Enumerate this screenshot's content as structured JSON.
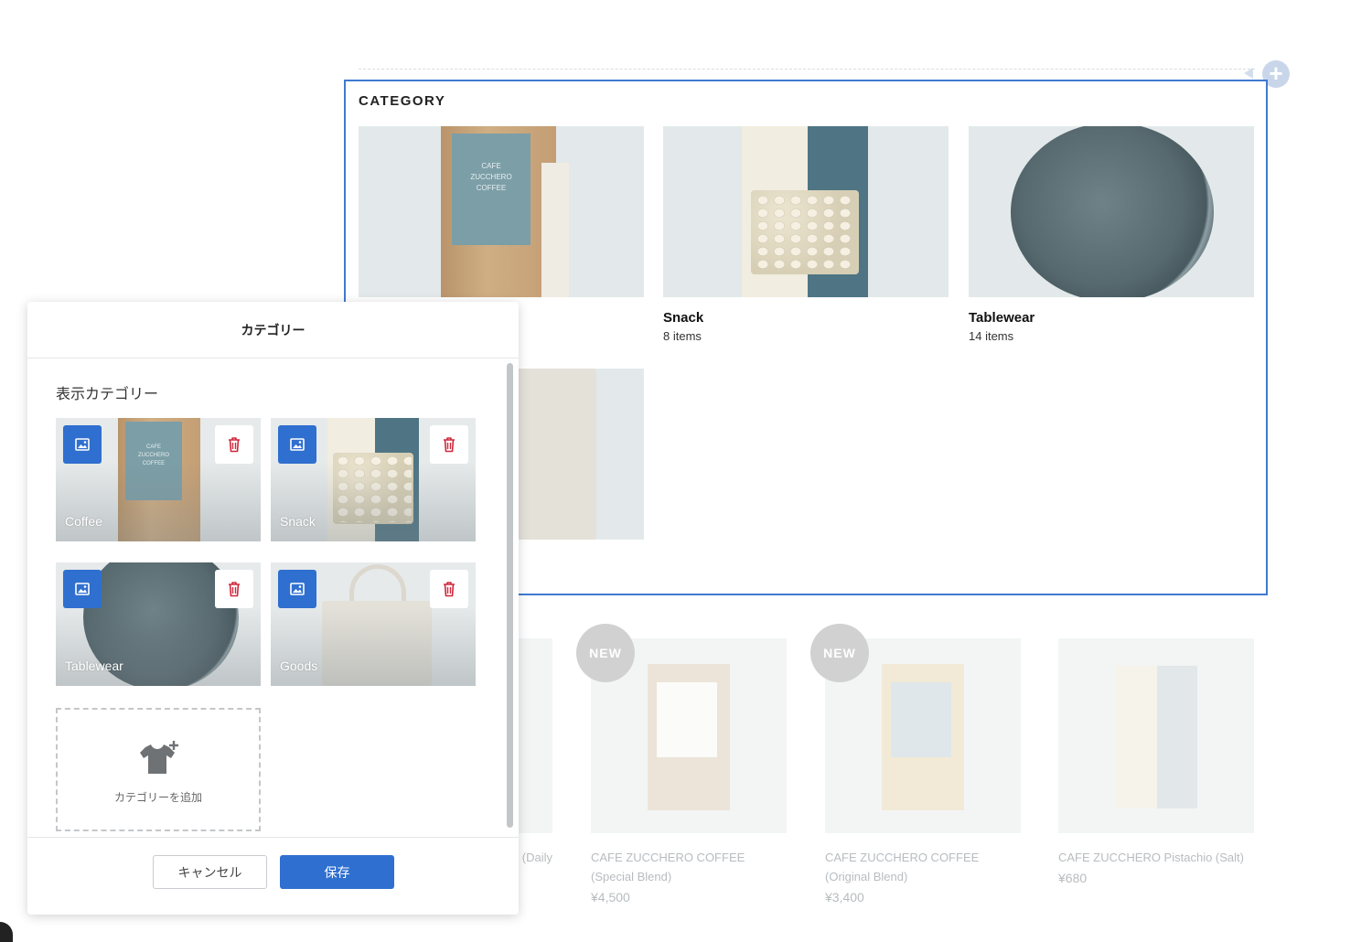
{
  "section": {
    "title": "CATEGORY",
    "add_icon": "plus-icon",
    "categories": [
      {
        "name": "Coffee",
        "count": "",
        "image": "coffee-bag"
      },
      {
        "name": "Snack",
        "count": "8 items",
        "image": "pistachio-pouch"
      },
      {
        "name": "Tablewear",
        "count": "14 items",
        "image": "plate"
      },
      {
        "name": "Goods",
        "count": "",
        "image": "tote-bag"
      }
    ]
  },
  "products": [
    {
      "name": "(Daily",
      "price": "",
      "new": false
    },
    {
      "name": "CAFE ZUCCHERO COFFEE (Special Blend)",
      "price": "¥4,500",
      "new": true
    },
    {
      "name": "CAFE ZUCCHERO COFFEE (Original Blend)",
      "price": "¥3,400",
      "new": true
    },
    {
      "name": "CAFE ZUCCHERO Pistachio (Salt)",
      "price": "¥680",
      "new": false
    }
  ],
  "badge_label": "NEW",
  "modal": {
    "title": "カテゴリー",
    "body_title": "表示カテゴリー",
    "tiles": [
      {
        "label": "Coffee"
      },
      {
        "label": "Snack"
      },
      {
        "label": "Tablewear"
      },
      {
        "label": "Goods"
      }
    ],
    "add_label": "カテゴリーを追加",
    "cancel_label": "キャンセル",
    "save_label": "保存"
  },
  "colors": {
    "accent": "#2f6fcf",
    "selection_border": "#3f7ad1",
    "delete_icon": "#d0283c"
  },
  "icons": {
    "image_button": "image-icon",
    "delete_button": "trash-icon",
    "add_category": "shirt-plus-icon"
  }
}
